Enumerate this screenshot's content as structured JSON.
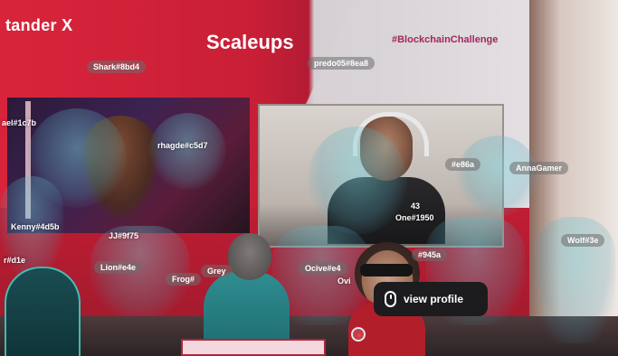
{
  "scene": {
    "brand_text": "tander X",
    "room_title": "Scaleups",
    "hashtag": "#BlockchainChallenge"
  },
  "name_tags": [
    {
      "label": "Shark#8bd4"
    },
    {
      "label": "predo05#8ea8"
    },
    {
      "label": "ael#1c7b"
    },
    {
      "label": "rhagde#c5d7"
    },
    {
      "label": "#e86a"
    },
    {
      "label": "AnnaGamer"
    },
    {
      "label": "43"
    },
    {
      "label": "One#1950"
    },
    {
      "label": "Kenny#4d5b"
    },
    {
      "label": "JJ#9f75"
    },
    {
      "label": "Wolf#3e"
    },
    {
      "label": "r#d1e"
    },
    {
      "label": "Lion#e4e"
    },
    {
      "label": "Grey"
    },
    {
      "label": "Frog#"
    },
    {
      "label": "Ocive#e4"
    },
    {
      "label": "Ovi"
    },
    {
      "label": "#945a"
    }
  ],
  "tooltip": {
    "label": "view profile",
    "icon": "mouse-icon"
  },
  "colors": {
    "brand_red": "#d8243b",
    "hashtag_purple": "#a0285c",
    "tooltip_bg": "#1c1c1e"
  }
}
